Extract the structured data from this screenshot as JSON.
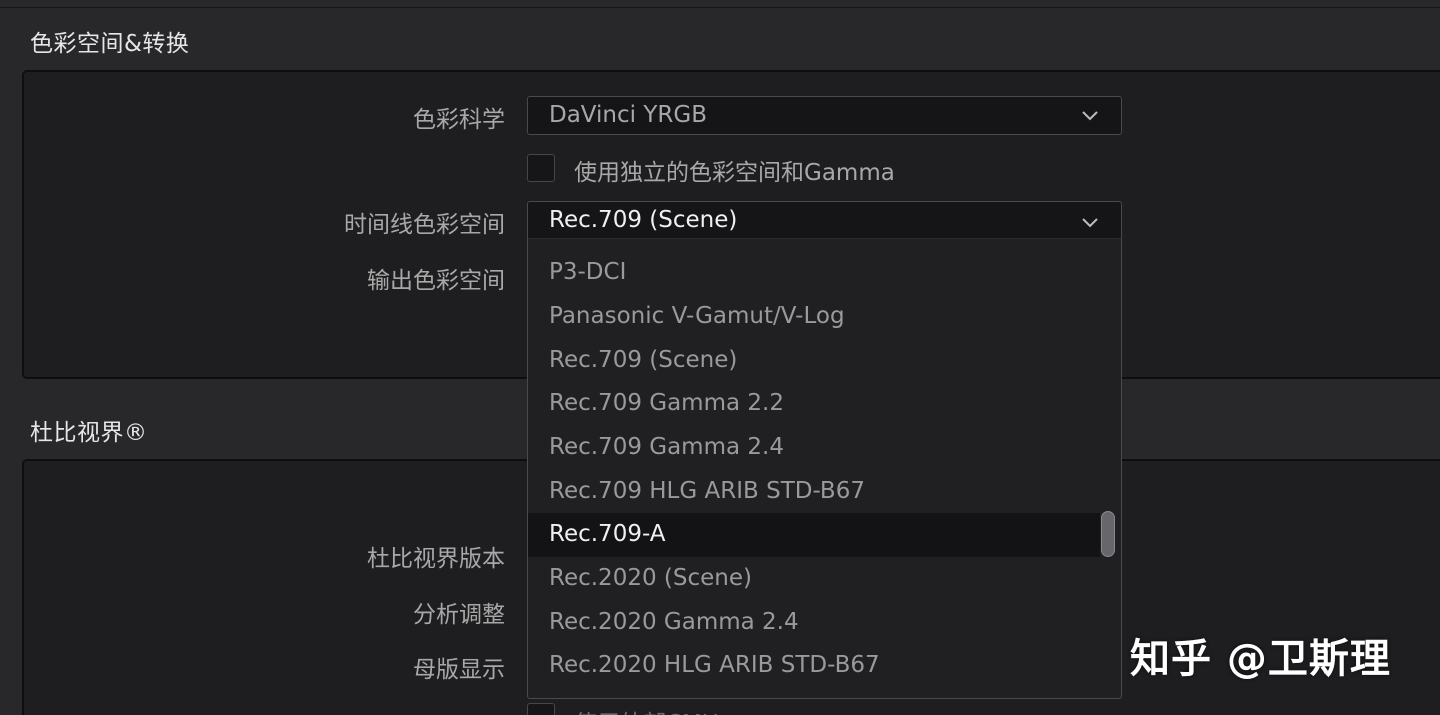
{
  "sections": {
    "color_space": {
      "title": "色彩空间&转换",
      "color_science_label": "色彩科学",
      "color_science_value": "DaVinci YRGB",
      "separate_gamma_checkbox_label": "使用独立的色彩空间和Gamma",
      "separate_gamma_checked": false,
      "timeline_color_space_label": "时间线色彩空间",
      "timeline_color_space_value": "Rec.709 (Scene)",
      "output_color_space_label": "输出色彩空间"
    },
    "dolby_vision": {
      "title": "杜比视界®",
      "version_label": "杜比视界版本",
      "analysis_label": "分析调整",
      "master_display_label": "母版显示",
      "external_cmu_label": "使用外部CMU"
    }
  },
  "dropdown": {
    "options": [
      "P3-DCI",
      "Panasonic V-Gamut/V-Log",
      "Rec.709 (Scene)",
      "Rec.709 Gamma 2.2",
      "Rec.709 Gamma 2.4",
      "Rec.709 HLG ARIB STD-B67",
      "Rec.709-A",
      "Rec.2020 (Scene)",
      "Rec.2020 Gamma 2.4",
      "Rec.2020 HLG ARIB STD-B67"
    ],
    "highlighted": "Rec.709-A"
  },
  "watermark": "知乎 @卫斯理",
  "colors": {
    "background": "#28282b",
    "panel": "#1e1e20",
    "field": "#151517",
    "label_text": "#a8a8a8",
    "value_text": "#f0f0f0",
    "dim_option_text": "#9a9a9a"
  }
}
